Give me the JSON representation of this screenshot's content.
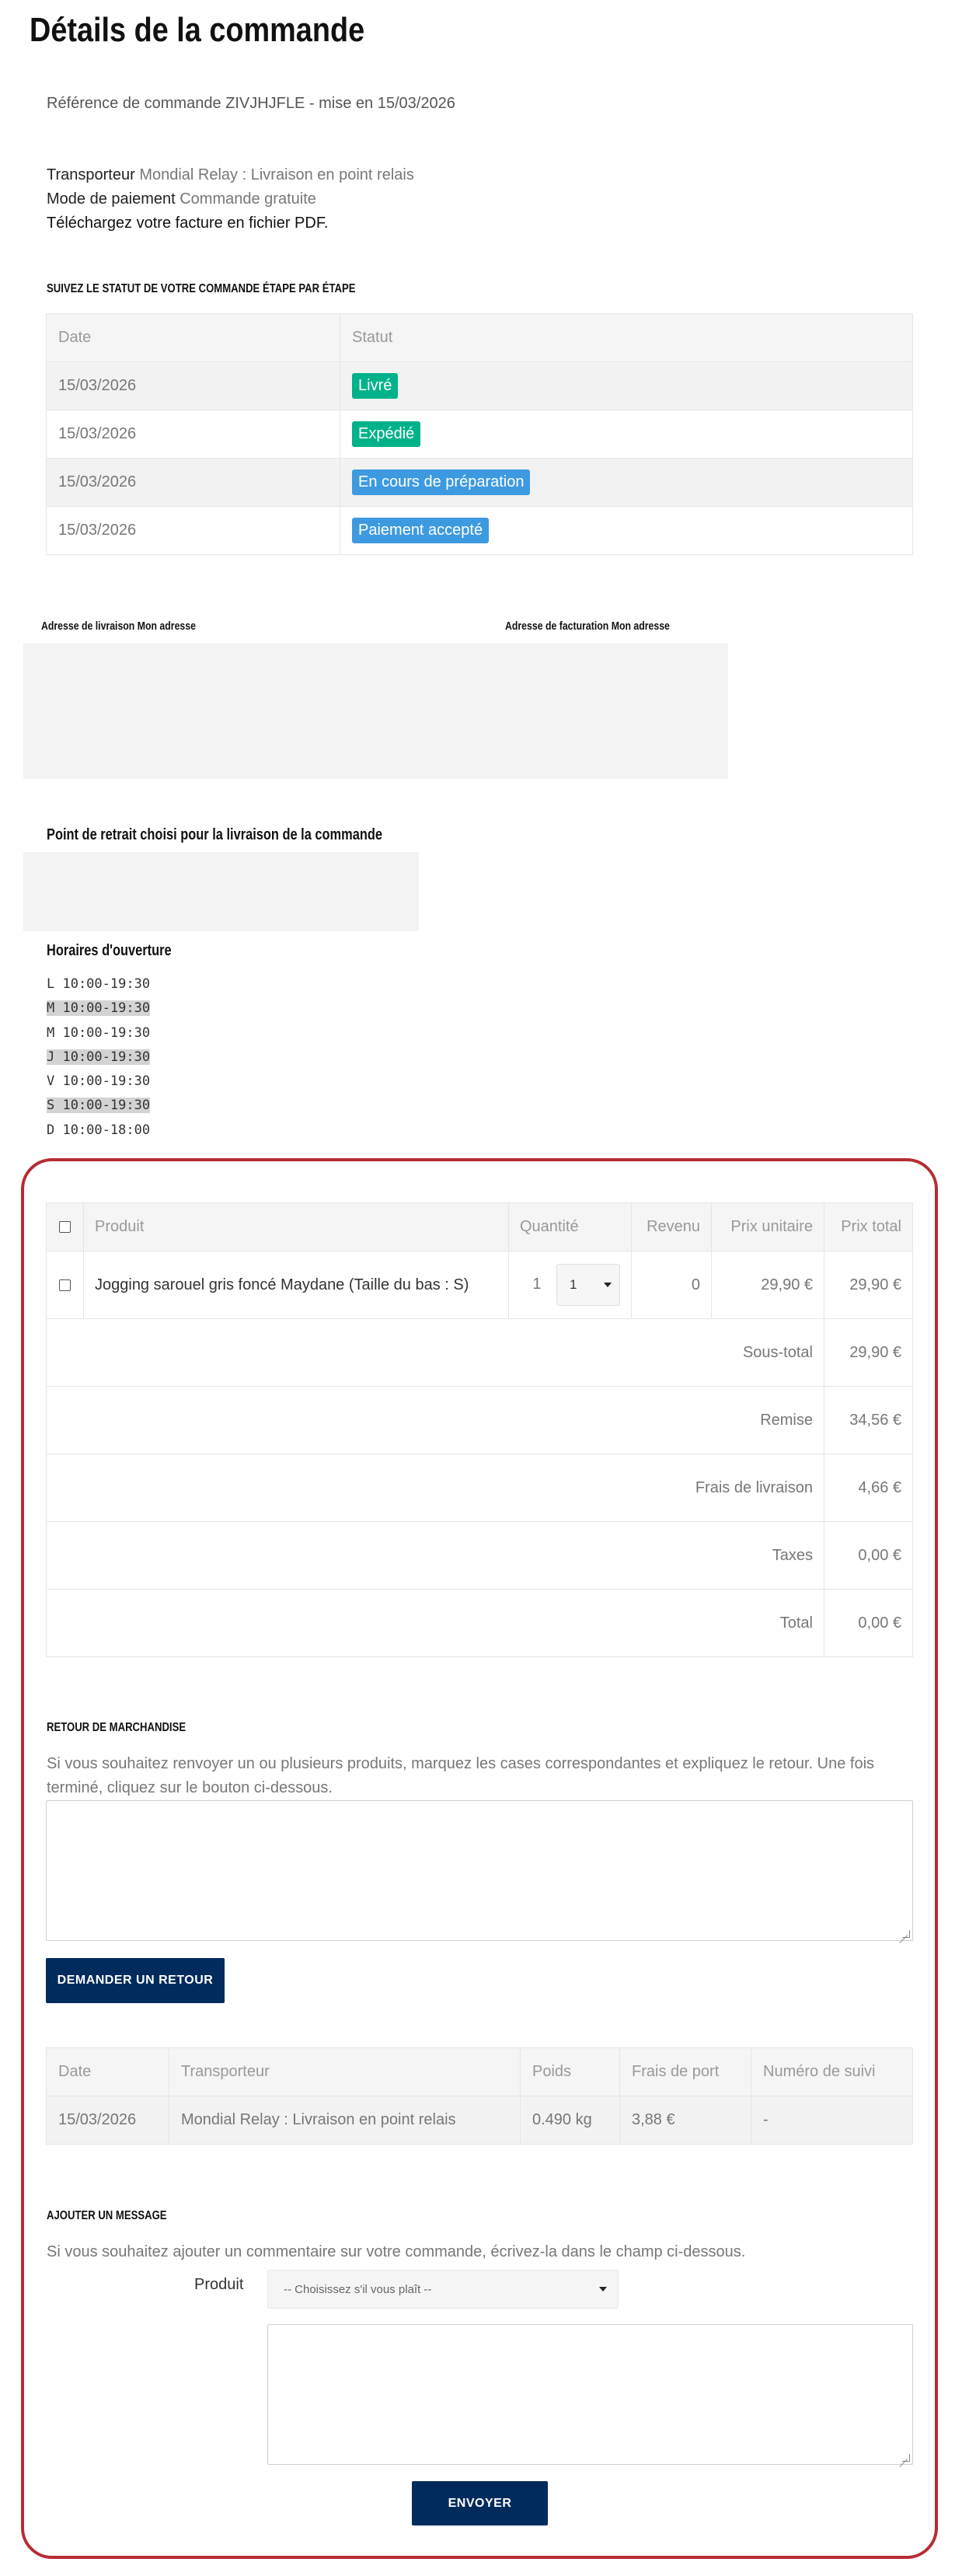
{
  "page_title": "Détails de la commande",
  "reference_line": "Référence de commande ZIVJHJFLE - mise en 15/03/2026",
  "carrier": {
    "label": "Transporteur",
    "value": "Mondial Relay : Livraison en point relais"
  },
  "payment": {
    "label": "Mode de paiement",
    "value": "Commande gratuite"
  },
  "invoice_link": "Téléchargez votre facture en fichier PDF.",
  "status_section": {
    "title": "Suivez le statut de votre commande étape par étape",
    "headers": [
      "Date",
      "Statut"
    ],
    "rows": [
      {
        "date": "15/03/2026",
        "status": "Livré",
        "color": "#00b28a"
      },
      {
        "date": "15/03/2026",
        "status": "Expédié",
        "color": "#00b28a"
      },
      {
        "date": "15/03/2026",
        "status": "En cours de préparation",
        "color": "#3e9ae0"
      },
      {
        "date": "15/03/2026",
        "status": "Paiement accepté",
        "color": "#3e9ae0"
      }
    ]
  },
  "addresses": {
    "delivery_label": "Adresse de livraison Mon adresse",
    "billing_label": "Adresse de facturation Mon adresse"
  },
  "pickup": {
    "title": "Point de retrait choisi pour la livraison de la commande",
    "hours_title": "Horaires d'ouverture",
    "hours": [
      {
        "text": "L 10:00-19:30",
        "highlight": false
      },
      {
        "text": "M 10:00-19:30",
        "highlight": true
      },
      {
        "text": "M 10:00-19:30",
        "highlight": false
      },
      {
        "text": "J 10:00-19:30",
        "highlight": true
      },
      {
        "text": "V 10:00-19:30",
        "highlight": false
      },
      {
        "text": "S 10:00-19:30",
        "highlight": true
      },
      {
        "text": "D 10:00-18:00",
        "highlight": false
      }
    ]
  },
  "products": {
    "headers": {
      "product": "Produit",
      "quantity": "Quantité",
      "revenue": "Revenu",
      "unit_price": "Prix unitaire",
      "total_price": "Prix total"
    },
    "items": [
      {
        "name": "Jogging sarouel gris foncé Maydane (Taille du bas : S)",
        "quantity": "1",
        "return_qty": "1",
        "revenue": "0",
        "unit_price": "29,90 €",
        "total_price": "29,90 €"
      }
    ],
    "totals": [
      {
        "label": "Sous-total",
        "value": "29,90 €"
      },
      {
        "label": "Remise",
        "value": "34,56 €"
      },
      {
        "label": "Frais de livraison",
        "value": "4,66 €"
      },
      {
        "label": "Taxes",
        "value": "0,00 €"
      },
      {
        "label": "Total",
        "value": "0,00 €"
      }
    ]
  },
  "returns": {
    "title": "Retour de marchandise",
    "description": "Si vous souhaitez renvoyer un ou plusieurs produits, marquez les cases correspondantes et expliquez le retour. Une fois terminé, cliquez sur le bouton ci-dessous.",
    "button": "Demander un retour"
  },
  "shipping": {
    "headers": [
      "Date",
      "Transporteur",
      "Poids",
      "Frais de port",
      "Numéro de suivi"
    ],
    "rows": [
      {
        "date": "15/03/2026",
        "carrier": "Mondial Relay : Livraison en point relais",
        "weight": "0.490 kg",
        "fee": "3,88 €",
        "tracking": "-"
      }
    ]
  },
  "message": {
    "title": "Ajouter un message",
    "description": "Si vous souhaitez ajouter un commentaire sur votre commande, écrivez-la dans le champ ci-dessous.",
    "product_label": "Produit",
    "select_placeholder": "-- Choisissez s'il vous plaît --",
    "button": "Envoyer"
  },
  "colors": {
    "frame": "#b62c33",
    "button": "#002b5c",
    "green_badge": "#00b28a",
    "blue_badge": "#3e9ae0"
  }
}
